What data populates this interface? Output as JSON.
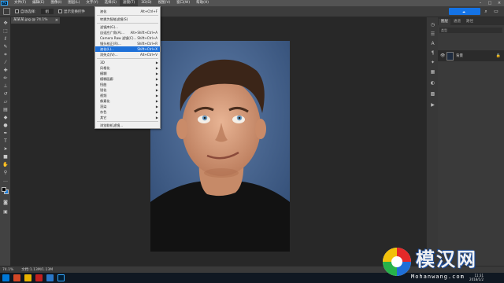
{
  "app": {
    "logo_text": "Ps"
  },
  "menubar": {
    "items": [
      "文件(F)",
      "编辑(E)",
      "图像(I)",
      "图层(L)",
      "文字(Y)",
      "选择(S)",
      "滤镜(T)",
      "3D(D)",
      "视图(V)",
      "窗口(W)",
      "帮助(H)"
    ],
    "active_index": 6
  },
  "options": {
    "auto_select_label": "自动选择:",
    "auto_select_value": "组",
    "transform_label": "显示变换控件"
  },
  "cloud_button": {
    "label": ""
  },
  "document_tab": {
    "title": "某某某.jpg @ 74.1%(RGB/8#)"
  },
  "filter_menu": {
    "items": [
      {
        "label": "液化",
        "shortcut": "Alt+Ctrl+F"
      },
      {
        "label": "转换为智能滤镜(S)",
        "shortcut": ""
      },
      {
        "label": "滤镜库(G)...",
        "shortcut": ""
      },
      {
        "label": "自适应广角(A)...",
        "shortcut": "Alt+Shift+Ctrl+A"
      },
      {
        "label": "Camera Raw 滤镜(C)...",
        "shortcut": "Shift+Ctrl+A"
      },
      {
        "label": "镜头校正(R)...",
        "shortcut": "Shift+Ctrl+R"
      },
      {
        "label": "液化(L)...",
        "shortcut": "Shift+Ctrl+X"
      },
      {
        "label": "消失点(V)...",
        "shortcut": "Alt+Ctrl+V"
      },
      {
        "label": "3D",
        "shortcut": ""
      },
      {
        "label": "风格化",
        "shortcut": ""
      },
      {
        "label": "模糊",
        "shortcut": ""
      },
      {
        "label": "模糊画廊",
        "shortcut": ""
      },
      {
        "label": "扭曲",
        "shortcut": ""
      },
      {
        "label": "锐化",
        "shortcut": ""
      },
      {
        "label": "视频",
        "shortcut": ""
      },
      {
        "label": "像素化",
        "shortcut": ""
      },
      {
        "label": "渲染",
        "shortcut": ""
      },
      {
        "label": "杂色",
        "shortcut": ""
      },
      {
        "label": "其它",
        "shortcut": ""
      },
      {
        "label": "浏览联机滤镜...",
        "shortcut": ""
      }
    ],
    "highlighted_index": 6
  },
  "layers_panel": {
    "tabs": [
      "图层",
      "通道",
      "路径"
    ],
    "filter_label": "类型",
    "layer_name": "背景"
  },
  "status": {
    "zoom": "74.1%",
    "doc_size": "文档:1.13M/1.13M"
  },
  "taskbar": {
    "time": "11:31",
    "date": "2018/1/2"
  },
  "watermark": {
    "title": "模汉网",
    "subtitle": "Mohanwang.com"
  },
  "colors": {
    "accent": "#1e70d8",
    "canvas_bg": "#282828",
    "panel_bg": "#3a3a3a"
  }
}
